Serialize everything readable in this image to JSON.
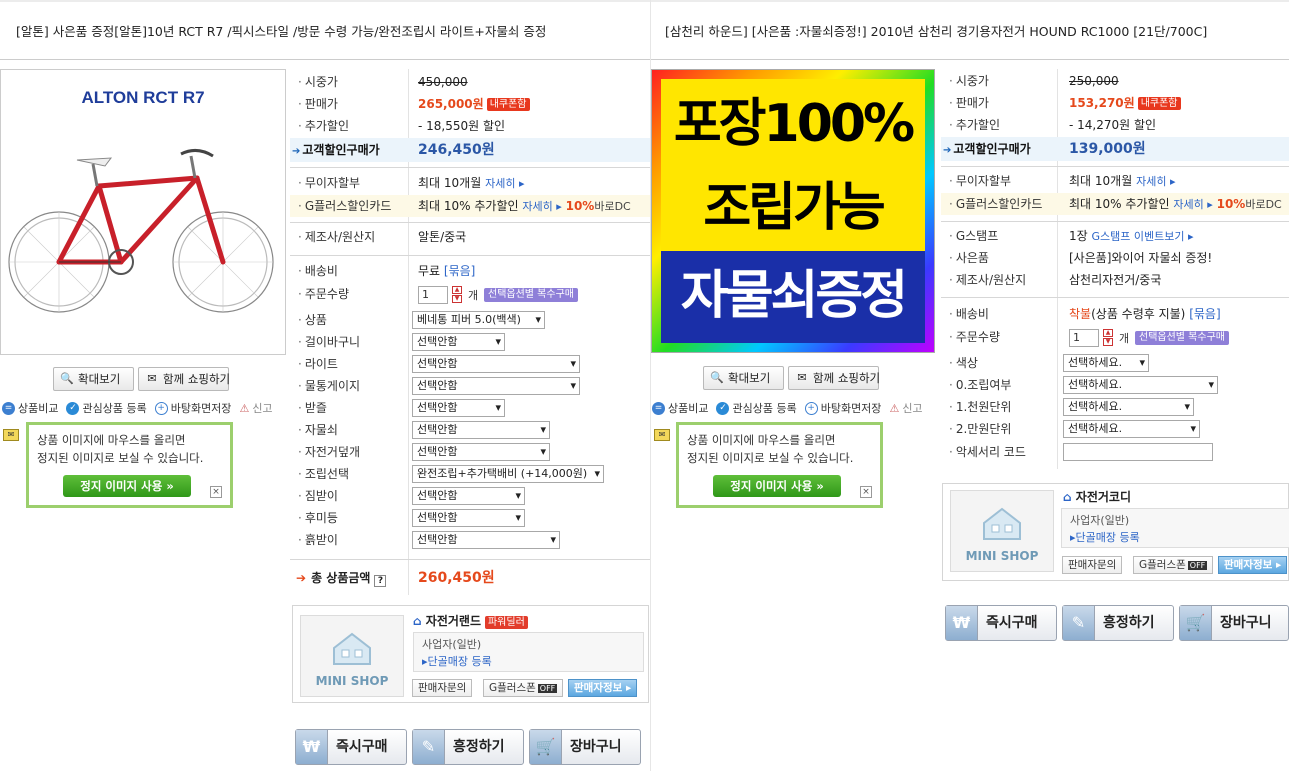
{
  "left": {
    "title": "[알톤] 사은품 증정[알톤]10년 RCT R7 /픽시스타일 /방문 수령 가능/완전조립시 라이트+자물쇠 증정",
    "image_caption": "ALTON RCT R7",
    "zoom_label": "확대보기",
    "share_label": "함께 쇼핑하기",
    "links": {
      "compare": "상품비교",
      "wish": "관심상품 등록",
      "desktop": "바탕화면저장",
      "report": "신고"
    },
    "tip": {
      "text1": "상품 이미지에 마우스를 올리면",
      "text2": "정지된 이미지로 보실 수 있습니다.",
      "button": "정지 이미지 사용",
      "close": "×"
    },
    "info": {
      "list_price_label": "시중가",
      "list_price": "450,000",
      "sale_price_label": "판매가",
      "sale_price": "265,000원",
      "coupon_badge": "내쿠폰함",
      "extra_label": "추가할인",
      "extra": "- 18,550원 할인",
      "customer_label": "고객할인구매가",
      "customer": "246,450원",
      "interest_label": "무이자할부",
      "interest": "최대 10개월",
      "detail": "자세히",
      "card_label": "G플러스할인카드",
      "card": "최대 10% 추가할인",
      "card_detail": "자세히",
      "card_rate": "10%",
      "card_dc": "바로DC",
      "maker_label": "제조사/원산지",
      "maker": "알톤/중국",
      "ship_label": "배송비",
      "ship": "무료",
      "ship_bundle": "[묶음]",
      "qty_label": "주문수량",
      "qty": "1",
      "qty_unit": "개",
      "multi_badge": "선택옵션별 복수구매",
      "options": [
        {
          "label": "상품",
          "value": "베네통 피버 5.0(백색)"
        },
        {
          "label": "걸이바구니",
          "value": "선택안함"
        },
        {
          "label": "라이트",
          "value": "선택안함"
        },
        {
          "label": "물통게이지",
          "value": "선택안함"
        },
        {
          "label": "받즐",
          "value": "선택안함"
        },
        {
          "label": "자물쇠",
          "value": "선택안함"
        },
        {
          "label": "자전거덮개",
          "value": "선택안함"
        },
        {
          "label": "조립선택",
          "value": "완전조립+추가택배비 (+14,000원)"
        },
        {
          "label": "짐받이",
          "value": "선택안함"
        },
        {
          "label": "후미등",
          "value": "선택안함"
        },
        {
          "label": "흙받이",
          "value": "선택안함"
        }
      ],
      "total_label": "총 상품금액",
      "total_help": "?",
      "total": "260,450원"
    },
    "shop": {
      "mini": "MINI SHOP",
      "name": "자전거랜드",
      "power": "파워딜러",
      "type": "사업자(일반)",
      "register": "단골매장 등록",
      "b1": "판매자문의",
      "b2": "G플러스폰",
      "b2off": "OFF",
      "b3": "판매자정보"
    },
    "buttons": {
      "buy": "즉시구매",
      "nego": "흥정하기",
      "cart": "장바구니"
    }
  },
  "right": {
    "title": "[삼천리 하운드] [사은품 :자물쇠증정!] 2010년 삼천리 경기용자전거 HOUND RC1000 [21단/700C]",
    "image_lines": [
      "포장100%",
      "조립가능",
      "자물쇠증정"
    ],
    "zoom_label": "확대보기",
    "share_label": "함께 쇼핑하기",
    "links": {
      "compare": "상품비교",
      "wish": "관심상품 등록",
      "desktop": "바탕화면저장",
      "report": "신고"
    },
    "tip": {
      "text1": "상품 이미지에 마우스를 올리면",
      "text2": "정지된 이미지로 보실 수 있습니다.",
      "button": "정지 이미지 사용",
      "close": "×"
    },
    "info": {
      "list_price_label": "시중가",
      "list_price": "250,000",
      "sale_price_label": "판매가",
      "sale_price": "153,270원",
      "coupon_badge": "내쿠폰함",
      "extra_label": "추가할인",
      "extra": "- 14,270원 할인",
      "customer_label": "고객할인구매가",
      "customer": "139,000원",
      "interest_label": "무이자할부",
      "interest": "최대 10개월",
      "detail": "자세히",
      "card_label": "G플러스할인카드",
      "card": "최대 10% 추가할인",
      "card_detail": "자세히",
      "card_rate": "10%",
      "card_dc": "바로DC",
      "stamp_label": "G스탬프",
      "stamp": "1장",
      "stamp_event": "G스탬프 이벤트보기",
      "gift_label": "사은품",
      "gift": "[사은품]와이어 자물쇠 증정!",
      "maker_label": "제조사/원산지",
      "maker": "삼천리자전거/중국",
      "ship_label": "배송비",
      "ship": "착불",
      "ship_note": "(상품 수령후 지불)",
      "ship_bundle": "[묶음]",
      "qty_label": "주문수량",
      "qty": "1",
      "qty_unit": "개",
      "multi_badge": "선택옵션별 복수구매",
      "options": [
        {
          "label": "색상",
          "value": "선택하세요."
        },
        {
          "label": "0.조립여부",
          "value": "선택하세요."
        },
        {
          "label": "1.천원단위",
          "value": "선택하세요."
        },
        {
          "label": "2.만원단위",
          "value": "선택하세요."
        }
      ],
      "code_label": "악세서리 코드",
      "code": ""
    },
    "shop": {
      "mini": "MINI SHOP",
      "name": "자전거코디",
      "type": "사업자(일반)",
      "register": "단골매장 등록",
      "b1": "판매자문의",
      "b2": "G플러스폰",
      "b2off": "OFF",
      "b3": "판매자정보"
    },
    "buttons": {
      "buy": "즉시구매",
      "nego": "흥정하기",
      "cart": "장바구니"
    }
  }
}
